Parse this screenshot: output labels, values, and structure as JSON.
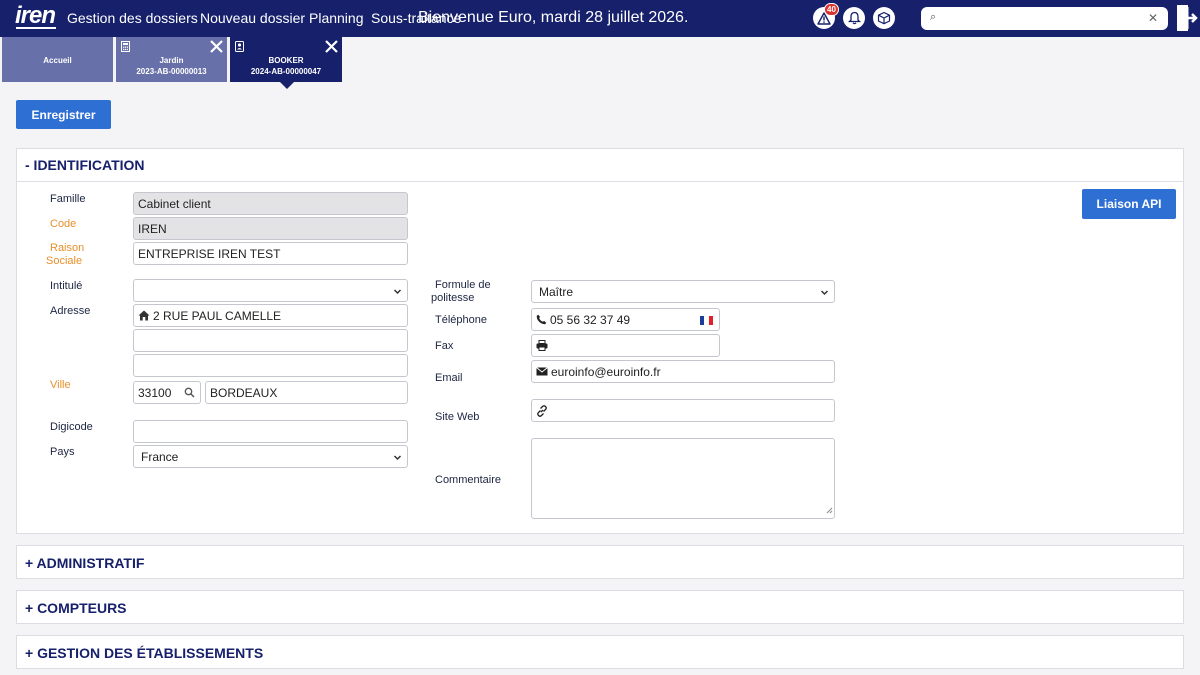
{
  "app": {
    "logo": "iren"
  },
  "nav": [
    "Gestion des dossiers",
    "Nouveau dossier",
    "Planning",
    "Sous-traitance"
  ],
  "welcome": "Bienvenue Euro, mardi 28 juillet 2026.",
  "notifications": {
    "alert_count": "40"
  },
  "search": {
    "placeholder": ""
  },
  "tabs": [
    {
      "label": "Accueil"
    },
    {
      "label": "Jardin",
      "ref": "2023-AB-00000013"
    },
    {
      "label": "BOOKER",
      "ref": "2024-AB-00000047"
    }
  ],
  "toolbar": {
    "save_label": "Enregistrer"
  },
  "identification": {
    "title": "- IDENTIFICATION",
    "api_button": "Liaison API",
    "left": {
      "famille": {
        "label": "Famille",
        "value": "Cabinet client"
      },
      "code": {
        "label": "Code",
        "value": "IREN"
      },
      "raison_sociale": {
        "label_line1": "Raison",
        "label_line2": "Sociale",
        "value": "ENTREPRISE IREN TEST"
      },
      "intitule": {
        "label": "Intitulé",
        "value": ""
      },
      "adresse": {
        "label": "Adresse",
        "line1": "2  RUE PAUL CAMELLE",
        "line2": "",
        "line3": ""
      },
      "ville": {
        "label": "Ville",
        "postal_code": "33100",
        "city": "BORDEAUX"
      },
      "digicode": {
        "label": "Digicode",
        "value": ""
      },
      "pays": {
        "label": "Pays",
        "value": "France"
      }
    },
    "right": {
      "formule": {
        "label_line1": "Formule de",
        "label_line2": "politesse",
        "value": "Maître"
      },
      "telephone": {
        "label": "Téléphone",
        "value": "05 56 32 37 49"
      },
      "fax": {
        "label": "Fax",
        "value": ""
      },
      "email": {
        "label": "Email",
        "value": "euroinfo@euroinfo.fr"
      },
      "site_web": {
        "label": "Site Web",
        "value": ""
      },
      "commentaire": {
        "label": "Commentaire",
        "value": ""
      }
    }
  },
  "sections": [
    {
      "title": "+ ADMINISTRATIF"
    },
    {
      "title": "+ COMPTEURS"
    },
    {
      "title": "+ GESTION DES ÉTABLISSEMENTS"
    }
  ],
  "colors": {
    "header": "#16206b",
    "tab_inactive": "#6770a9",
    "primary": "#2e6fd4",
    "required_label": "#e8902a",
    "readonly_field": "#e3e2e4",
    "alert_badge": "#d9332e"
  }
}
